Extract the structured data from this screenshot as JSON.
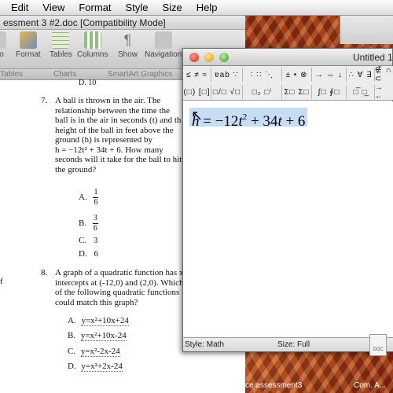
{
  "menubar": {
    "items": [
      "Edit",
      "View",
      "Format",
      "Style",
      "Size",
      "Help"
    ]
  },
  "word": {
    "title": "essment 3 #2.doc [Compatibility Mode]",
    "toolbar": [
      "o",
      "Format",
      "Tables",
      "Columns",
      "Show",
      "Navigation"
    ],
    "ribbon": [
      "Tables",
      "Charts",
      "SmartArt Graphics"
    ],
    "cut_text": "D. 10",
    "q7": {
      "number": "7.",
      "lines": [
        "A ball is thrown in the air.  The",
        "relationship between the time the",
        "ball is in the air in seconds (t) and th",
        "height of the ball in feet above the",
        "ground (h) is represented by",
        "h = −12t² + 34t + 6. How many",
        "seconds will it take for the ball to hit",
        "the ground?"
      ],
      "options": [
        {
          "letter": "A.",
          "num": "1",
          "den": "6"
        },
        {
          "letter": "B.",
          "num": "3",
          "den": "6"
        },
        {
          "letter": "C.",
          "value": "3"
        },
        {
          "letter": "D.",
          "value": "6"
        }
      ]
    },
    "q8": {
      "number": "8.",
      "lines": [
        "A graph of a quadratic function has x",
        "intercepts at (-12,0) and (2,0). Which",
        "of the following quadratic functions",
        "could match this graph?"
      ],
      "options": [
        {
          "letter": "A.",
          "value": "y=x²+10x+24"
        },
        {
          "letter": "B.",
          "value": "y=x²+10x-24"
        },
        {
          "letter": "C.",
          "value": "y=x²-2x-24"
        },
        {
          "letter": "D.",
          "value": "y=x²+2x-24"
        }
      ]
    },
    "left_frag": "f"
  },
  "eq": {
    "title": "Untitled 1",
    "palette_row1": [
      "≤ ≠ ≈",
      "ɐab ∵",
      "∶ ∷ ⋱",
      "± • ⊗",
      "→ ⇔ ↓",
      "∴ ∀ ∃",
      "∉ ∩ ⊂"
    ],
    "palette_row2": [
      "(□) [□]",
      "□/□ √□",
      "□₂ □ⁱ",
      "Σ□ Σ□",
      "∫□ ∮□",
      "□̅ □̲",
      "→ ←"
    ],
    "formula": {
      "var": "h",
      "eq": " = −12",
      "t1": "t",
      "pow": "2",
      "rest": " + 34",
      "t2": "t",
      "tail": " + 6"
    },
    "status_style": "Style: Math",
    "status_size": "Size: Full"
  },
  "desktop": {
    "dock_labels": [
      "ce assessment3",
      "Com. A..."
    ],
    "doc_icon_label": "DOC"
  }
}
